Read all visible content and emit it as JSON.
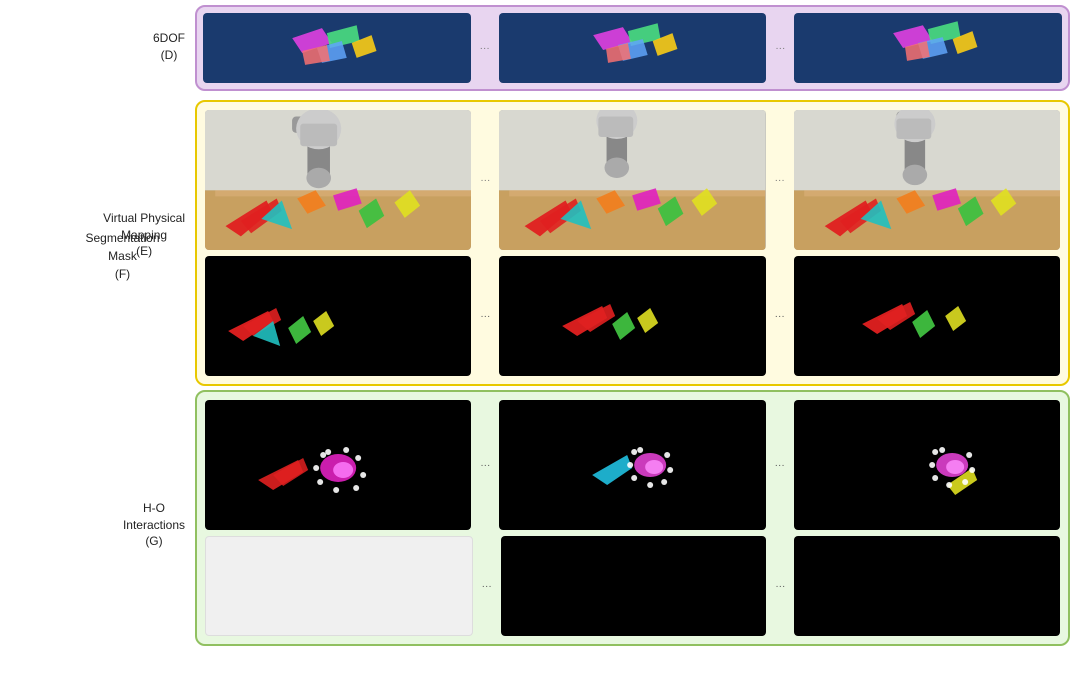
{
  "sections": {
    "dof": {
      "label": "6DOF\n(D)",
      "border_color": "#c090d0",
      "bg_color": "#e8d5f0"
    },
    "vpm": {
      "label": "Virtual Physical\nMapping\n(E)",
      "border_color": "#e8c800",
      "bg_color": "#fffbe0"
    },
    "seg": {
      "label": "Segmentation\nMask\n(F)"
    },
    "ho": {
      "label": "H-O\nInteractions\n(G)",
      "border_color": "#90c060",
      "bg_color": "#e8f8e0"
    }
  },
  "dots_separator": "···"
}
